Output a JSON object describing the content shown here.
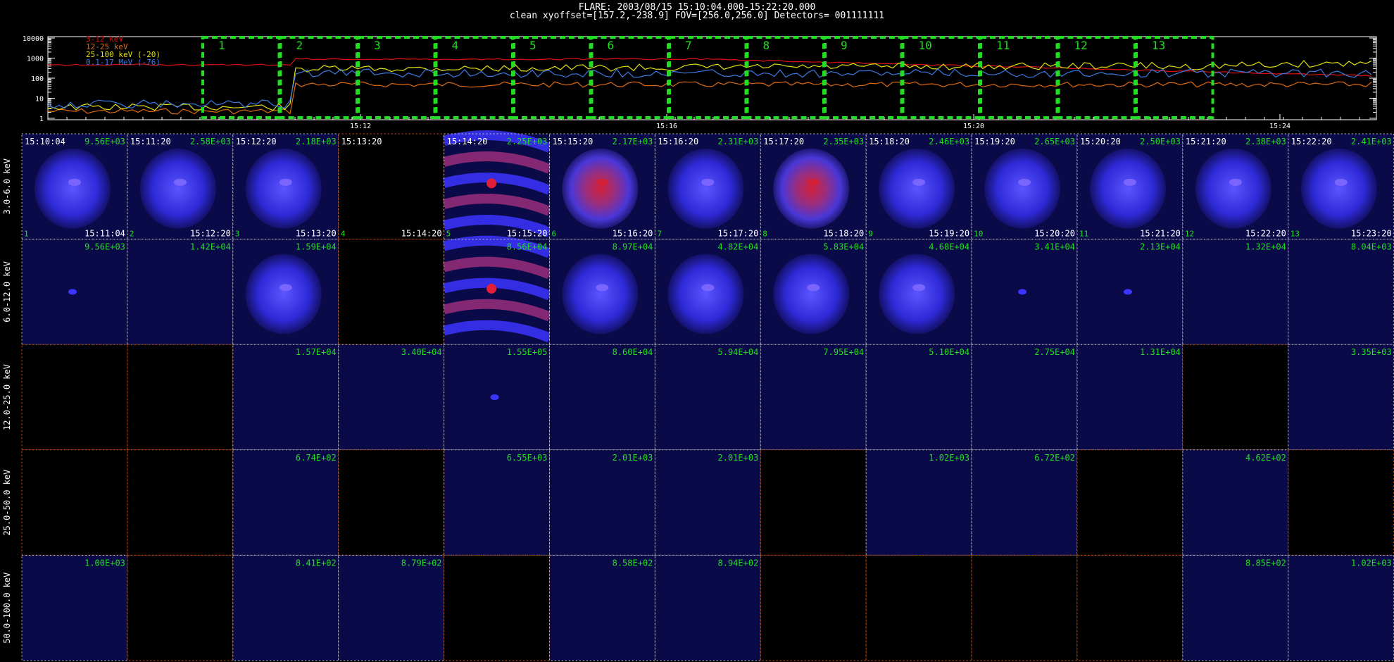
{
  "header": {
    "line1": "FLARE: 2003/08/15 15:10:04.000-15:22:20.000",
    "line2": "clean    xyoffset=[157.2,-238.9]    FOV=[256.0,256.0]    Detectors= 001111111"
  },
  "lightcurve": {
    "y_ticks": [
      "10000",
      "1000",
      "100",
      "10",
      "1"
    ],
    "x_ticks": [
      "15:12",
      "15:16",
      "15:20",
      "15:24"
    ],
    "legend": [
      {
        "label": "3-12 keV",
        "color": "#e01010"
      },
      {
        "label": "12-25 keV",
        "color": "#e06a10"
      },
      {
        "label": "25-100 keV (-20)",
        "color": "#e0e010"
      },
      {
        "label": "0.1-17 MeV (-76)",
        "color": "#3a7ae0"
      }
    ],
    "intervals": [
      "1",
      "2",
      "3",
      "4",
      "5",
      "6",
      "7",
      "8",
      "9",
      "10",
      "11",
      "12",
      "13"
    ],
    "interval_color": "#22dd22"
  },
  "grid": {
    "row_labels": [
      "3.0-6.0 keV",
      "6.0-12.0 keV",
      "12.0-25.0 keV",
      "25.0-50.0 keV",
      "50.0-100.0 keV"
    ],
    "start_times": [
      "15:10:04",
      "15:11:20",
      "15:12:20",
      "15:13:20",
      "15:14:20",
      "15:15:20",
      "15:16:20",
      "15:17:20",
      "15:18:20",
      "15:19:20",
      "15:20:20",
      "15:21:20",
      "15:22:20"
    ],
    "end_times": [
      "15:11:04",
      "15:12:20",
      "15:13:20",
      "15:14:20",
      "15:15:20",
      "15:16:20",
      "15:17:20",
      "15:18:20",
      "15:19:20",
      "15:20:20",
      "15:21:20",
      "15:22:20",
      "15:23:20"
    ],
    "max_values": [
      [
        "9.56E+03",
        "2.58E+03",
        "2.18E+03",
        "",
        "2.25E+03",
        "2.17E+03",
        "2.31E+03",
        "2.35E+03",
        "2.46E+03",
        "2.65E+03",
        "2.50E+03",
        "2.38E+03",
        "2.41E+03"
      ],
      [
        "9.56E+03",
        "1.42E+04",
        "1.59E+04",
        "",
        "8.56E+04",
        "8.97E+04",
        "4.82E+04",
        "5.83E+04",
        "4.68E+04",
        "3.41E+04",
        "2.13E+04",
        "1.32E+04",
        "8.04E+03"
      ],
      [
        "",
        "",
        "1.57E+04",
        "3.40E+04",
        "1.55E+05",
        "8.60E+04",
        "5.94E+04",
        "7.95E+04",
        "5.10E+04",
        "2.75E+04",
        "1.31E+04",
        "",
        "3.35E+03"
      ],
      [
        "",
        "",
        "6.74E+02",
        "",
        "6.55E+03",
        "2.01E+03",
        "2.01E+03",
        "",
        "1.02E+03",
        "6.72E+02",
        "",
        "4.62E+02",
        ""
      ],
      [
        "1.00E+03",
        "",
        "8.41E+02",
        "8.79E+02",
        "",
        "8.58E+02",
        "8.94E+02",
        "",
        "",
        "",
        "",
        "8.85E+02",
        "1.02E+03"
      ]
    ],
    "cell_kind": [
      [
        "blob",
        "blob",
        "blob",
        "empty",
        "streak",
        "red",
        "blob",
        "red",
        "blob",
        "blob",
        "blob",
        "blob",
        "blob"
      ],
      [
        "dot",
        "dark",
        "blob",
        "empty",
        "streak",
        "blob",
        "blob",
        "blob",
        "blob",
        "dot",
        "dot",
        "dark",
        "dark"
      ],
      [
        "empty",
        "empty",
        "dark",
        "dark",
        "dot",
        "dark",
        "dark",
        "dark",
        "dark",
        "dark",
        "dark",
        "empty",
        "dark"
      ],
      [
        "empty",
        "empty",
        "dark",
        "empty",
        "dark",
        "dark",
        "dark",
        "empty",
        "dark",
        "dark",
        "empty",
        "dark",
        "empty"
      ],
      [
        "dark",
        "empty",
        "dark",
        "dark",
        "empty",
        "dark",
        "dark",
        "empty",
        "empty",
        "empty",
        "empty",
        "dark",
        "dark"
      ]
    ],
    "colors": {
      "time_text": "#ffffff",
      "value_text": "#22dd22",
      "frame_white": "#cccccc",
      "frame_orange": "#e05a10"
    }
  }
}
